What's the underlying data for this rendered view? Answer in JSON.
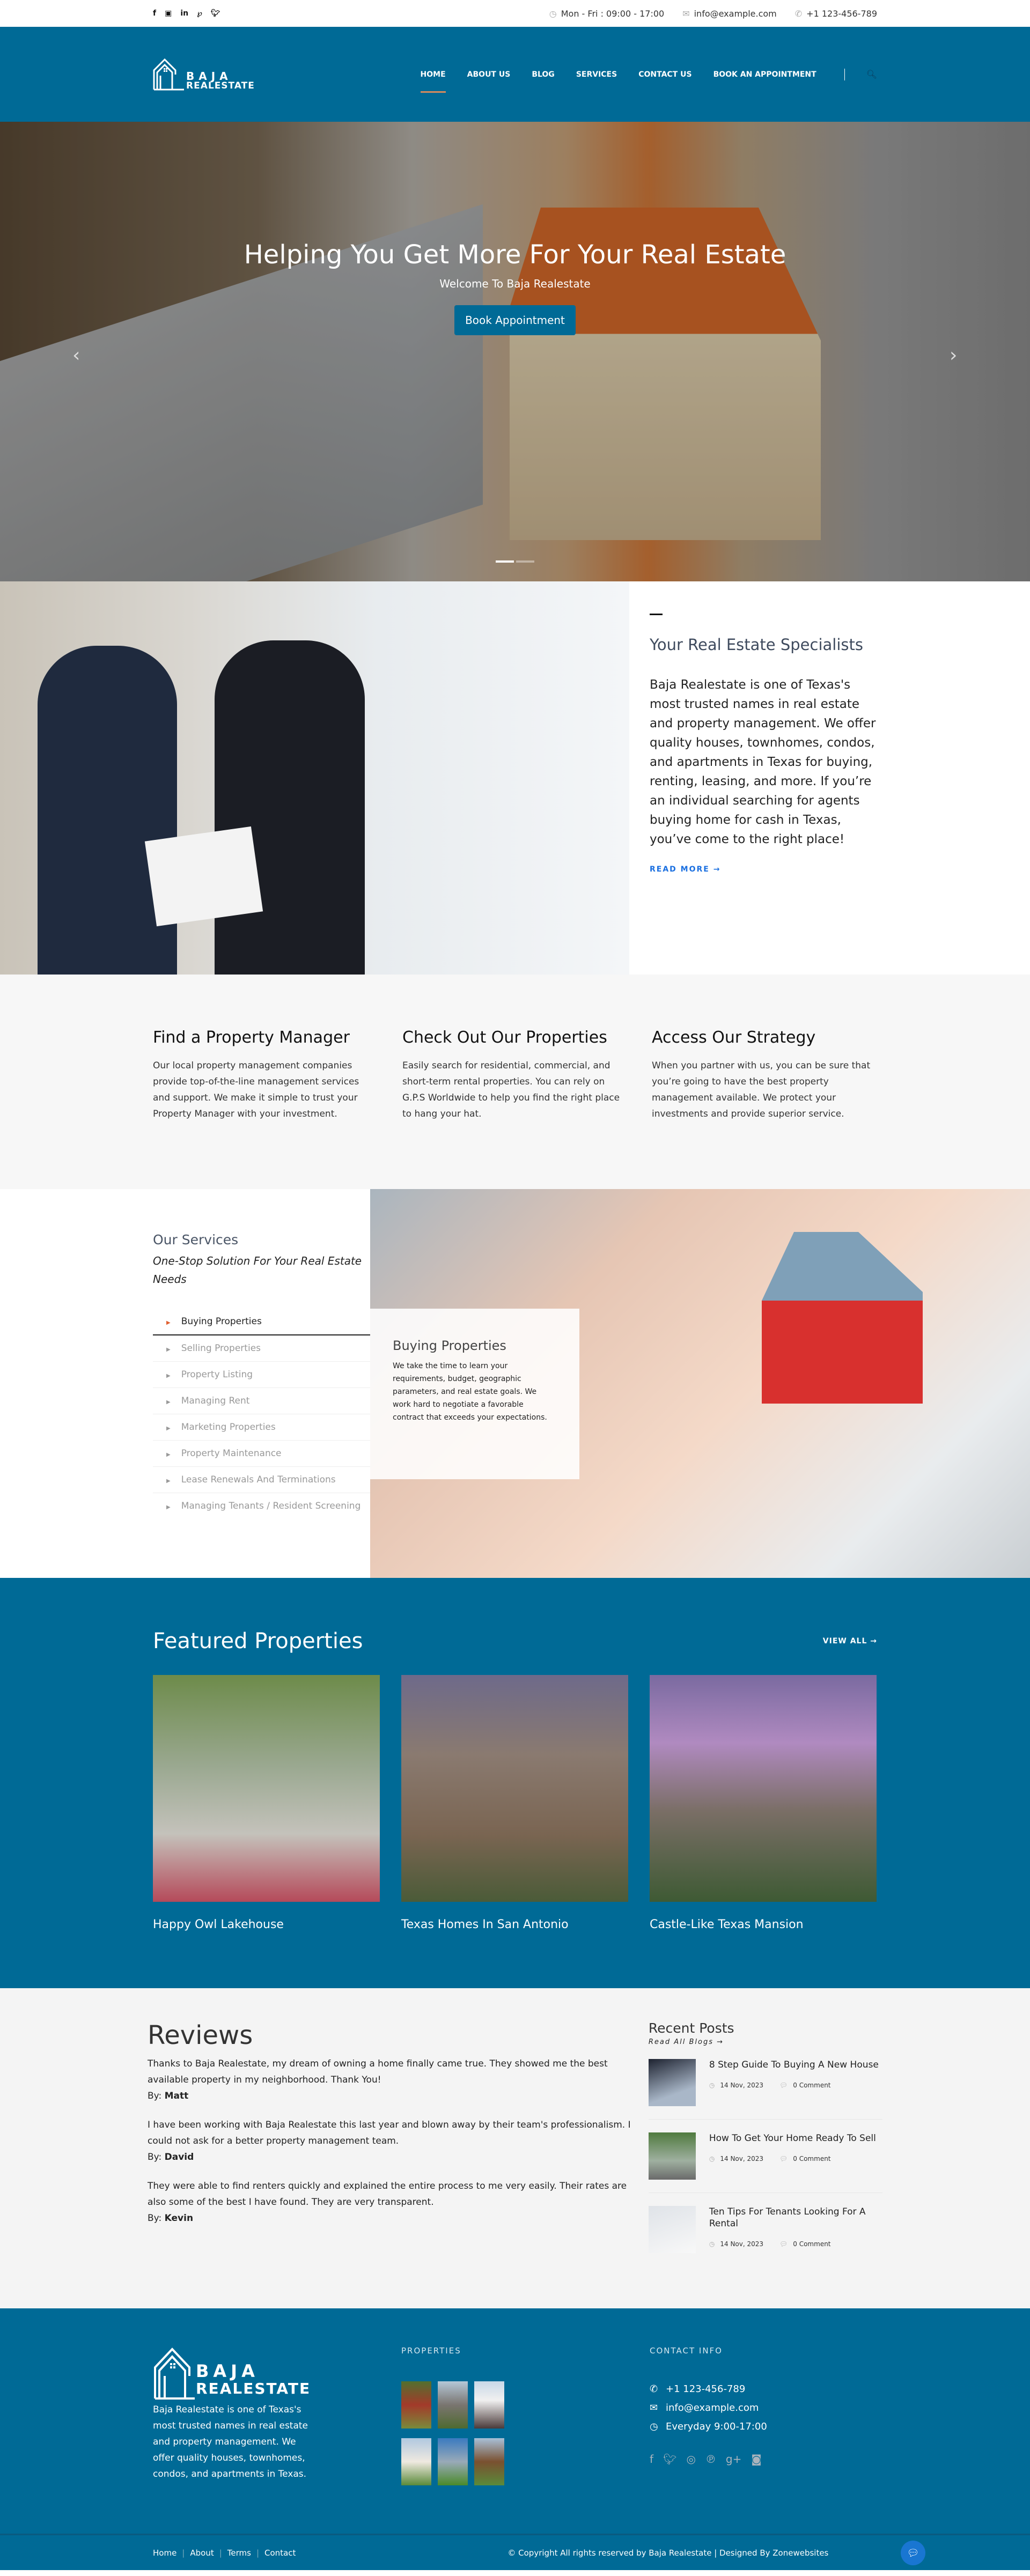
{
  "topbar": {
    "social": [
      "facebook",
      "flickr",
      "linkedin",
      "pinterest",
      "twitter"
    ],
    "hours": "Mon - Fri : 09:00 - 17:00",
    "email": "info@example.com",
    "phone": "+1 123-456-789"
  },
  "header": {
    "logo_line1": "BAJA",
    "logo_line2": "REALESTATE",
    "nav": [
      {
        "label": "HOME",
        "active": true
      },
      {
        "label": "ABOUT US"
      },
      {
        "label": "BLOG"
      },
      {
        "label": "SERVICES"
      },
      {
        "label": "CONTACT US"
      },
      {
        "label": "BOOK AN APPOINTMENT"
      }
    ]
  },
  "hero": {
    "title": "Helping You Get More For Your Real Estate",
    "subtitle": "Welcome To Baja Realestate",
    "button": "Book Appointment",
    "prev": "‹",
    "next": "›",
    "slides": 2,
    "active_slide": 1
  },
  "about": {
    "title": "Your Real Estate Specialists",
    "body": "Baja Realestate is one of Texas's most trusted names in real estate and property management. We offer quality houses, townhomes, condos, and apartments in Texas for buying, renting, leasing, and more. If you’re an individual searching for agents buying home for cash in Texas, you’ve come to the right place!",
    "read_more": "READ MORE →"
  },
  "features": [
    {
      "title": "Find a Property Manager",
      "body": "Our local property management companies provide top-of-the-line management services and support. We make it simple to trust your Property Manager with your investment."
    },
    {
      "title": "Check Out Our Properties",
      "body": "Easily search for residential, commercial, and short-term rental properties. You can rely on G.P.S Worldwide to help you find the right place to hang your hat."
    },
    {
      "title": "Access Our Strategy",
      "body": "When you partner with us, you can be sure that you’re going to have the best property management available. We protect your investments and provide superior service."
    }
  ],
  "services": {
    "title": "Our Services",
    "subtitle": "One-Stop Solution For Your Real Estate Needs",
    "items": [
      "Buying Properties",
      "Selling Properties",
      "Property Listing",
      "Managing Rent",
      "Marketing Properties",
      "Property Maintenance",
      "Lease Renewals And Terminations",
      "Managing Tenants / Resident Screening"
    ],
    "active_item": "Buying Properties",
    "card_title": "Buying Properties",
    "card_body": "We take the time to learn your requirements, budget, geographic parameters, and real estate goals. We work hard to negotiate a favorable contract that exceeds your expectations."
  },
  "featured": {
    "title": "Featured Properties",
    "view_all": "VIEW ALL →",
    "properties": [
      "Happy Owl Lakehouse",
      "Texas Homes In San Antonio",
      "Castle-Like Texas Mansion"
    ]
  },
  "reviews": {
    "title": "Reviews",
    "by_label": "By:",
    "items": [
      {
        "text": "Thanks to Baja Realestate, my dream of owning a home finally came true. They showed me the best available property in my neighborhood. Thank You!",
        "author": "Matt"
      },
      {
        "text": "I have been working with Baja Realestate this last year and blown away by their team's professionalism. I could not ask for a better property management team.",
        "author": "David"
      },
      {
        "text": "They were able to find renters quickly and explained the entire process to me very easily. Their rates are also some of the best I have found. They are very transparent.",
        "author": "Kevin"
      }
    ]
  },
  "recent_posts": {
    "title": "Recent Posts",
    "read_all": "Read All Blogs →",
    "posts": [
      {
        "title": "8 Step Guide To Buying A New House",
        "date": "14 Nov, 2023",
        "comments": "0 Comment"
      },
      {
        "title": "How To Get Your Home Ready To Sell",
        "date": "14 Nov, 2023",
        "comments": "0 Comment"
      },
      {
        "title": "Ten Tips For Tenants Looking For A Rental",
        "date": "14 Nov, 2023",
        "comments": "0 Comment"
      }
    ]
  },
  "footer": {
    "logo_line1": "BAJA",
    "logo_line2": "REALESTATE",
    "about": "Baja Realestate is one of Texas's most trusted names in real estate and property management. We offer quality houses, townhomes, condos, and apartments in Texas.",
    "properties_title": "PROPERTIES",
    "contact_title": "CONTACT INFO",
    "phone": "+1 123-456-789",
    "email": "info@example.com",
    "hours": "Everyday 9:00-17:00",
    "social": [
      "facebook",
      "twitter",
      "dribbble",
      "pinterest",
      "google-plus",
      "instagram"
    ],
    "links": [
      "Home",
      "About",
      "Terms",
      "Contact"
    ],
    "copyright": "© Copyright All rights reserved by Baja Realestate | Designed By Zonewebsites"
  },
  "colors": {
    "brand_blue": "#006a96",
    "nav_active_underline": "#d68a5c",
    "link_blue": "#1a6fe0",
    "accent_orange": "#e06030"
  }
}
